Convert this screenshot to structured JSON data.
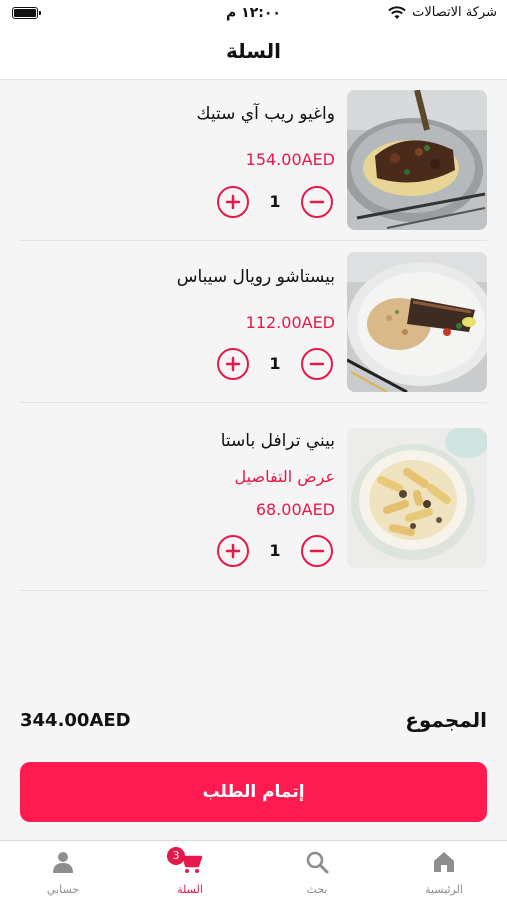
{
  "status_bar": {
    "time": "١٢:٠٠ م",
    "carrier": "شركة الاتصالات"
  },
  "header": {
    "title": "السلة"
  },
  "cart_items": [
    {
      "name": "واغيو ريب آي ستيك",
      "details_link": "",
      "price": "154.00AED",
      "quantity": "1",
      "image": "wagyu-steak-plate"
    },
    {
      "name": "بيستاشو رويال سيباس",
      "details_link": "",
      "price": "112.00AED",
      "quantity": "1",
      "image": "seabass-plate"
    },
    {
      "name": "بيني ترافل باستا",
      "details_link": "عرض التفاصيل",
      "price": "68.00AED",
      "quantity": "1",
      "image": "penne-pasta-plate"
    }
  ],
  "summary": {
    "total_label": "المجموع",
    "total_value": "344.00AED"
  },
  "checkout": {
    "label": "إتمام الطلب"
  },
  "tabs": [
    {
      "label": "الرئيسية",
      "icon": "home-icon"
    },
    {
      "label": "بحث",
      "icon": "search-icon"
    },
    {
      "label": "السلة",
      "icon": "cart-icon",
      "badge": "3",
      "active": true
    },
    {
      "label": "حسابي",
      "icon": "user-icon"
    }
  ],
  "colors": {
    "accent": "#e5194a",
    "button": "#ff1a4f",
    "background": "#f5f5f5"
  }
}
